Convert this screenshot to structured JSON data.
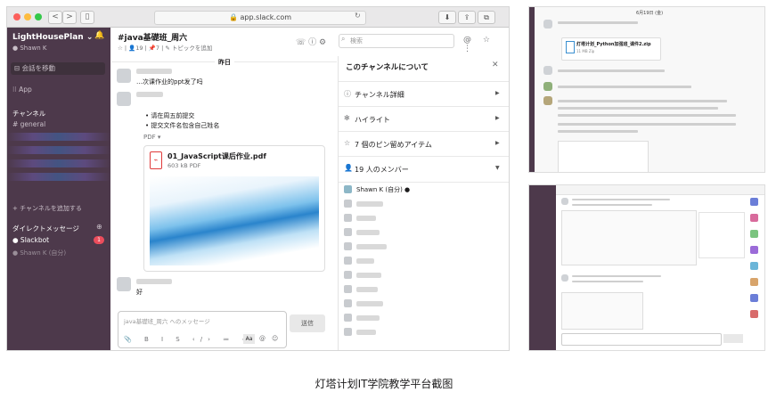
{
  "browser": {
    "url": "app.slack.com",
    "back_label": "<",
    "forward_label": ">",
    "colors": {
      "close": "#fc605c",
      "minimize": "#fdbc40",
      "zoom": "#34c84a"
    }
  },
  "sidebar": {
    "team_name": "LightHousePlan",
    "team_chevron": "⌄",
    "user_status": "● Shawn K",
    "jump_label": "⊟ 会話を移動",
    "apps_label": "⁝⁝ App",
    "channels_heading": "チャンネル",
    "channel_general": "# general",
    "add_channel_label": "+ チャンネルを追加する",
    "dm_heading": "ダイレクトメッセージ",
    "dm_slackbot": "● Slackbot",
    "dm_badge": "1",
    "dm_self": "● Shawn K (自分)",
    "bg_color": "#4d394b"
  },
  "channel": {
    "title": "#java基礎班_周六",
    "meta": "☆ | 👤19 | 📌7 | ✎ トピックを追加",
    "header_icons": "☏  ⓘ  ⚙",
    "search_placeholder": "検索",
    "right_icons": "@ ☆ ⋮"
  },
  "messages": {
    "date_divider": "昨日",
    "msg1_text": "…次课作业的ppt发了吗",
    "msg2_lines": [
      "请在周五前提交",
      "提交文件名包含自己姓名"
    ],
    "pdf_label": "PDF ▾",
    "file_name": "01_JavaScript课后作业.pdf",
    "file_size": "603 kB PDF",
    "msg3_text": "好",
    "compose_placeholder": "java基礎班_周六 へのメッセージ",
    "compose_tools": "📎 B I S ‹/› ≔ ⋯",
    "aa_label": "Aa",
    "send_label": "送信"
  },
  "channel_info": {
    "title": "このチャンネルについて",
    "close_label": "✕",
    "items": [
      {
        "icon": "ⓘ",
        "label": "チャンネル詳細",
        "arrow": "▶"
      },
      {
        "icon": "✻",
        "label": "ハイライト",
        "arrow": "▶"
      },
      {
        "icon": "☆",
        "label": "7 個のピン留めアイテム",
        "arrow": "▶"
      },
      {
        "icon": "👤",
        "label": "19 人のメンバー",
        "arrow": "▼"
      }
    ],
    "first_member": "Shawn K (自分) ●"
  },
  "shot1": {
    "date_label": "6月19日 (金)",
    "file_title": "灯塔计划_Python加强班_课件2.zip",
    "file_size": "11 MB Zip"
  },
  "caption": "灯塔计划IT学院教学平台截图"
}
